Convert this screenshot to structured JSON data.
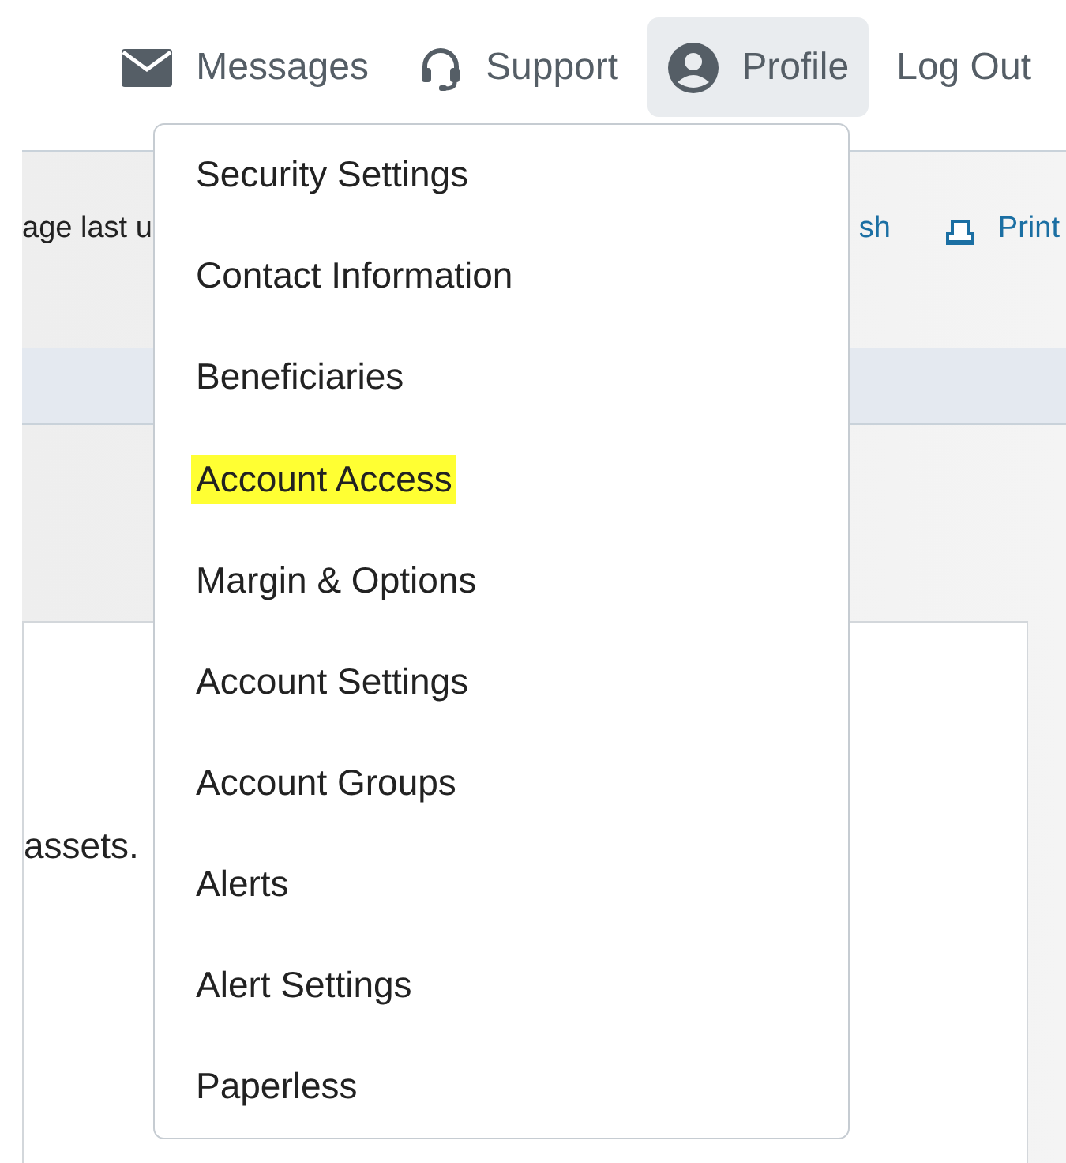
{
  "nav": [
    {
      "kind": "messages",
      "label": "Messages",
      "selected": false
    },
    {
      "kind": "support",
      "label": "Support",
      "selected": false
    },
    {
      "kind": "profile",
      "label": "Profile",
      "selected": true
    },
    {
      "kind": "logout",
      "label": "Log Out",
      "selected": false
    }
  ],
  "page": {
    "updated_text": "age last u",
    "refresh_link": "sh",
    "print_link": "Print",
    "body_text": "assets."
  },
  "profile_menu": [
    {
      "label": "Security Settings",
      "highlighted": false
    },
    {
      "label": "Contact Information",
      "highlighted": false
    },
    {
      "label": "Beneficiaries",
      "highlighted": false
    },
    {
      "label": "Account Access",
      "highlighted": true
    },
    {
      "label": "Margin & Options",
      "highlighted": false
    },
    {
      "label": "Account Settings",
      "highlighted": false
    },
    {
      "label": "Account Groups",
      "highlighted": false
    },
    {
      "label": "Alerts",
      "highlighted": false
    },
    {
      "label": "Alert Settings",
      "highlighted": false
    },
    {
      "label": "Paperless",
      "highlighted": false
    }
  ]
}
